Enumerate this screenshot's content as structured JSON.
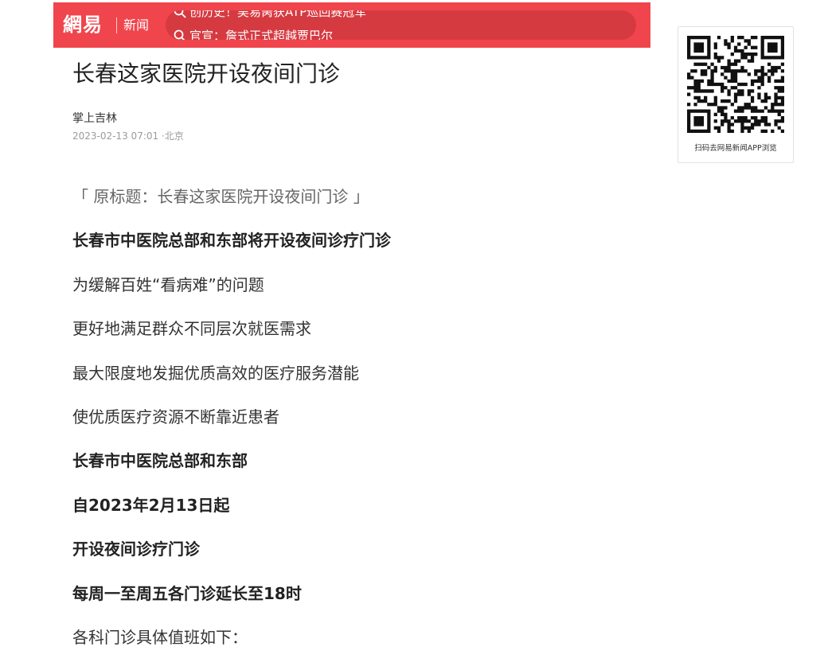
{
  "header": {
    "logo_text": "網易",
    "channel_label": "新闻",
    "ticker": [
      "创历史！吴易昺获ATP巡回赛冠军",
      "官宣：詹式正式超越贾巴尔"
    ],
    "colors": {
      "bar": "#f0454c",
      "pill": "#cd373e"
    }
  },
  "article": {
    "title": "长春这家医院开设夜间门诊",
    "source": "掌上吉林",
    "datetime": "2023-02-13 07:01",
    "location": "·北京",
    "paragraphs": [
      {
        "text": "「 原标题：长春这家医院开设夜间门诊 」",
        "style": "original-title"
      },
      {
        "text": "长春市中医院总部和东部将开设夜间诊疗门诊",
        "style": "bold"
      },
      {
        "text": "为缓解百姓“看病难”的问题",
        "style": "normal"
      },
      {
        "text": "更好地满足群众不同层次就医需求",
        "style": "normal"
      },
      {
        "text": "最大限度地发掘优质高效的医疗服务潜能",
        "style": "normal"
      },
      {
        "text": "使优质医疗资源不断靠近患者",
        "style": "normal"
      },
      {
        "text": "长春市中医院总部和东部",
        "style": "bold"
      },
      {
        "text": "自2023年2月13日起",
        "style": "bold"
      },
      {
        "text": "开设夜间诊疗门诊",
        "style": "bold"
      },
      {
        "text": "每周一至周五各门诊延长至18时",
        "style": "bold"
      },
      {
        "text": "各科门诊具体值班如下：",
        "style": "normal"
      }
    ]
  },
  "qr": {
    "label": "扫码去网易新闻APP浏览",
    "icon": "qr-code-icon"
  }
}
